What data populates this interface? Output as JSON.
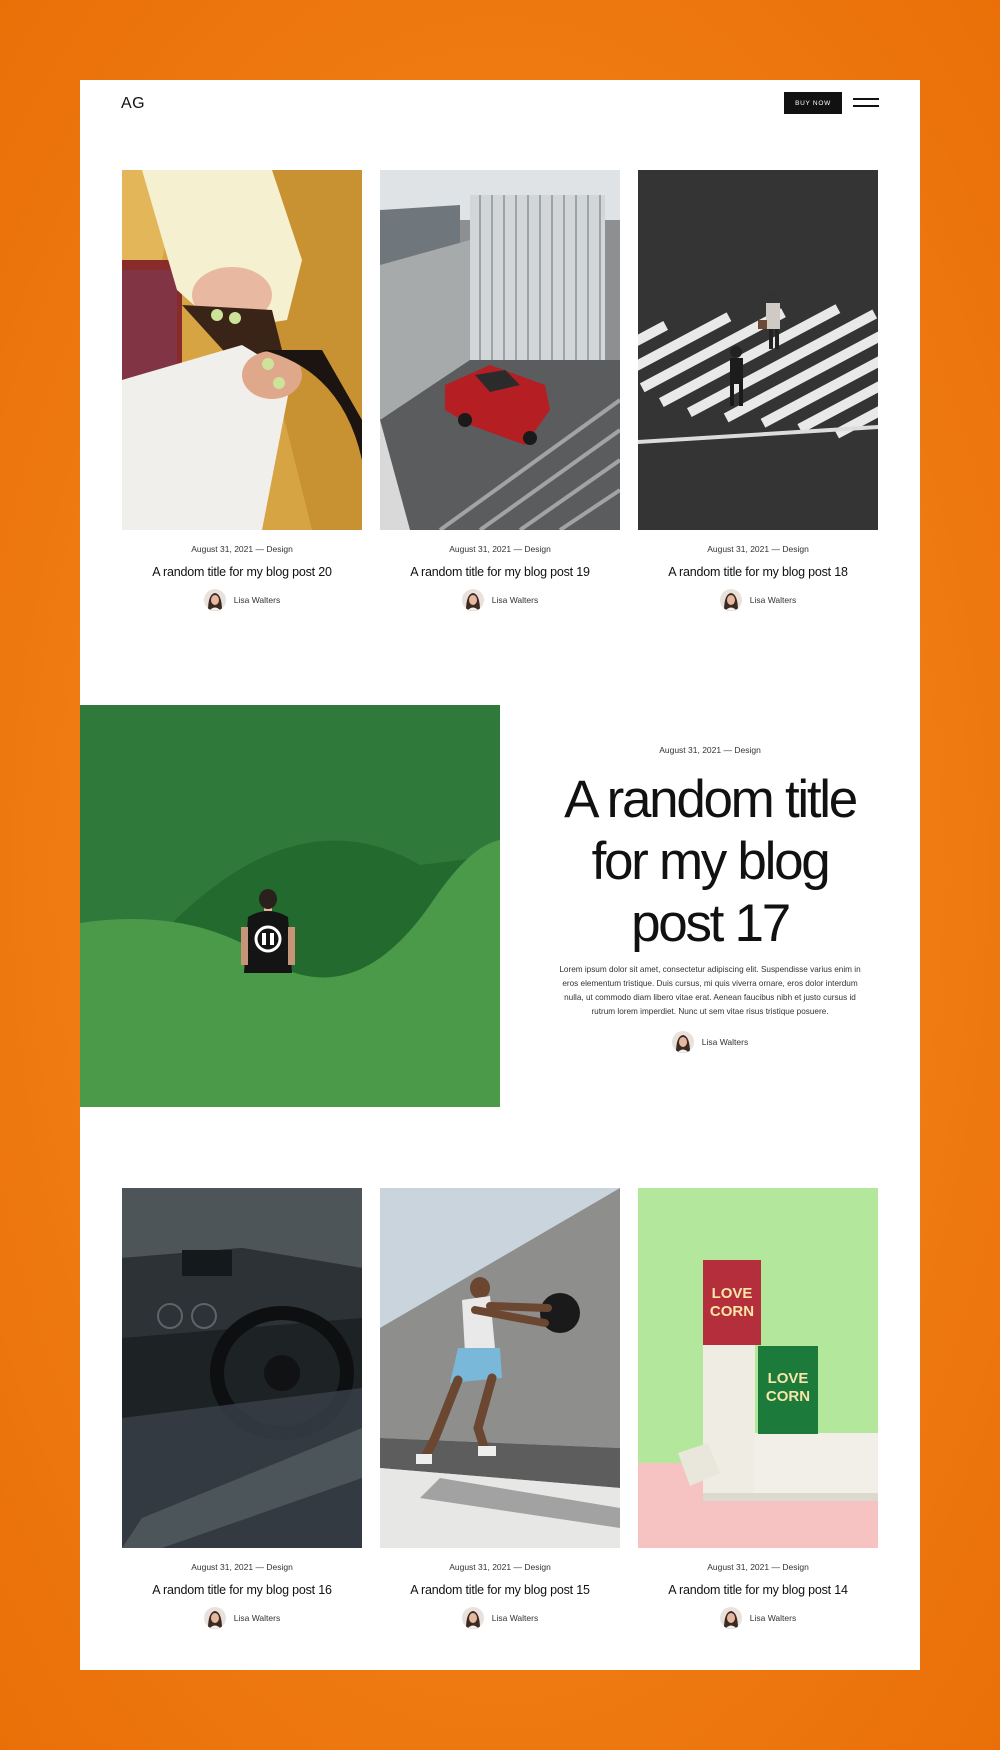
{
  "header": {
    "logo": "AG",
    "buy_button": "BUY NOW"
  },
  "posts_top": [
    {
      "meta": "August 31, 2021 — Design",
      "title": "A random title for my blog post 20",
      "author": "Lisa Walters",
      "image": "women-cucumber-eyes-photo"
    },
    {
      "meta": "August 31, 2021 — Design",
      "title": "A random title for my blog post 19",
      "author": "Lisa Walters",
      "image": "red-car-parking-photo"
    },
    {
      "meta": "August 31, 2021 — Design",
      "title": "A random title for my blog post 18",
      "author": "Lisa Walters",
      "image": "crosswalk-aerial-photo"
    }
  ],
  "featured": {
    "meta": "August 31, 2021 — Design",
    "title": "A random title for my blog post 17",
    "excerpt": "Lorem ipsum dolor sit amet, consectetur adipiscing elit. Suspendisse varius enim in eros elementum tristique. Duis cursus, mi quis viverra ornare, eros dolor interdum nulla, ut commodo diam libero vitae erat. Aenean faucibus nibh et justo cursus id rutrum lorem imperdiet. Nunc ut sem vitae risus tristique posuere.",
    "author": "Lisa Walters",
    "image": "man-green-hills-photo"
  },
  "posts_bottom": [
    {
      "meta": "August 31, 2021 — Design",
      "title": "A random title for my blog post 16",
      "author": "Lisa Walters",
      "image": "car-interior-photo"
    },
    {
      "meta": "August 31, 2021 — Design",
      "title": "A random title for my blog post 15",
      "author": "Lisa Walters",
      "image": "medicine-ball-athlete-photo"
    },
    {
      "meta": "August 31, 2021 — Design",
      "title": "A random title for my blog post 14",
      "author": "Lisa Walters",
      "image": "love-corn-product-photo"
    }
  ],
  "product_labels": {
    "line1": "LOVE",
    "line2": "CORN"
  },
  "colors": {
    "background": "#f07d14",
    "page": "#ffffff",
    "button": "#111111",
    "feature_green": "#3d8a3f"
  }
}
